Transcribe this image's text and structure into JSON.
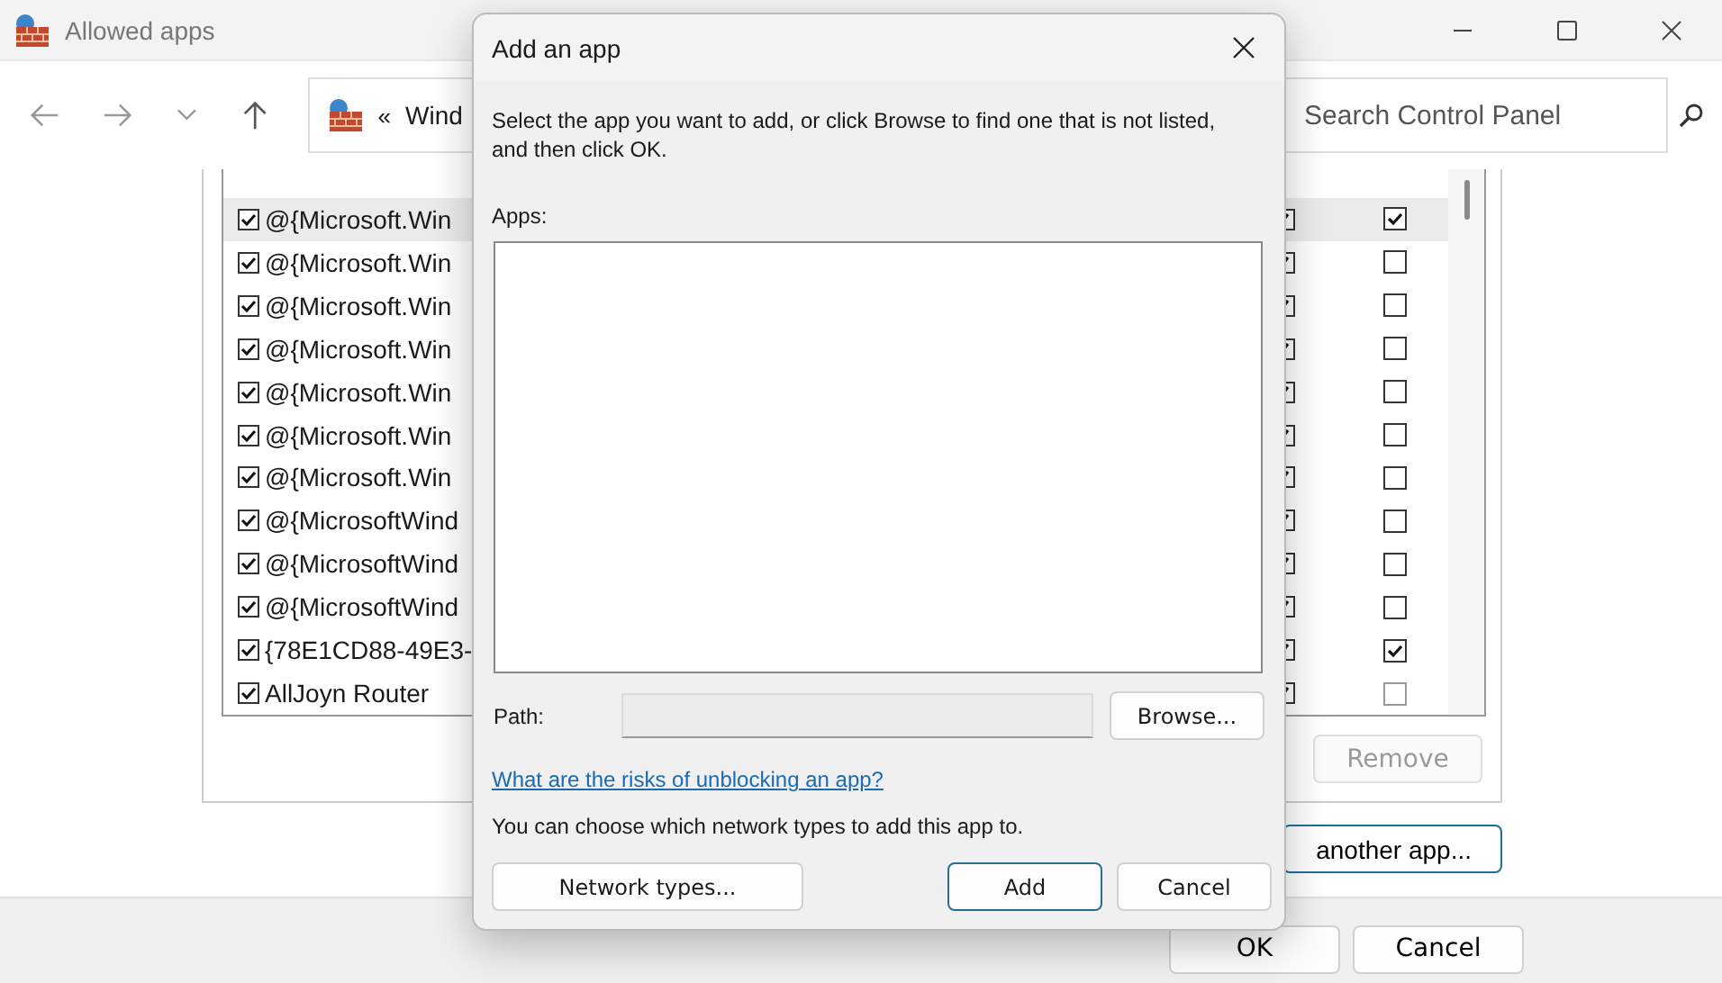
{
  "window": {
    "title": "Allowed apps"
  },
  "address_bar": {
    "chevrons": "«",
    "path": "Wind"
  },
  "search": {
    "placeholder": "Search Control Panel"
  },
  "list": {
    "rows": [
      {
        "name": "@{Microsoft.Win",
        "private": true,
        "public": true,
        "selected": true
      },
      {
        "name": "@{Microsoft.Win",
        "private": true,
        "public": false,
        "selected": false
      },
      {
        "name": "@{Microsoft.Win",
        "private": true,
        "public": false,
        "selected": false
      },
      {
        "name": "@{Microsoft.Win",
        "private": true,
        "public": false,
        "selected": false
      },
      {
        "name": "@{Microsoft.Win",
        "private": true,
        "public": false,
        "selected": false
      },
      {
        "name": "@{Microsoft.Win",
        "private": true,
        "public": false,
        "selected": false
      },
      {
        "name": "@{Microsoft.Win",
        "private": true,
        "public": false,
        "selected": false
      },
      {
        "name": "@{MicrosoftWind",
        "private": true,
        "public": false,
        "selected": false
      },
      {
        "name": "@{MicrosoftWind",
        "private": true,
        "public": false,
        "selected": false
      },
      {
        "name": "@{MicrosoftWind",
        "private": true,
        "public": false,
        "selected": false
      },
      {
        "name": "{78E1CD88-49E3-",
        "private": true,
        "public": true,
        "selected": false
      },
      {
        "name": "AllJoyn Router",
        "private": true,
        "public": false,
        "selected": false
      }
    ]
  },
  "remove_button": {
    "label": "Remove",
    "disabled": true
  },
  "allow_button": {
    "label": "another app..."
  },
  "footer_buttons": [
    "OK",
    "Cancel"
  ],
  "dialog": {
    "title": "Add an app",
    "description": "Select the app you want to add, or click Browse to find one that is not listed, and then click OK.",
    "apps_label": "Apps:",
    "path_label": "Path:",
    "browse": "Browse...",
    "link": "What are the risks of unblocking an app?",
    "note": "You can choose which network types to add this app to.",
    "network_types": "Network types...",
    "add": "Add",
    "cancel": "Cancel"
  }
}
